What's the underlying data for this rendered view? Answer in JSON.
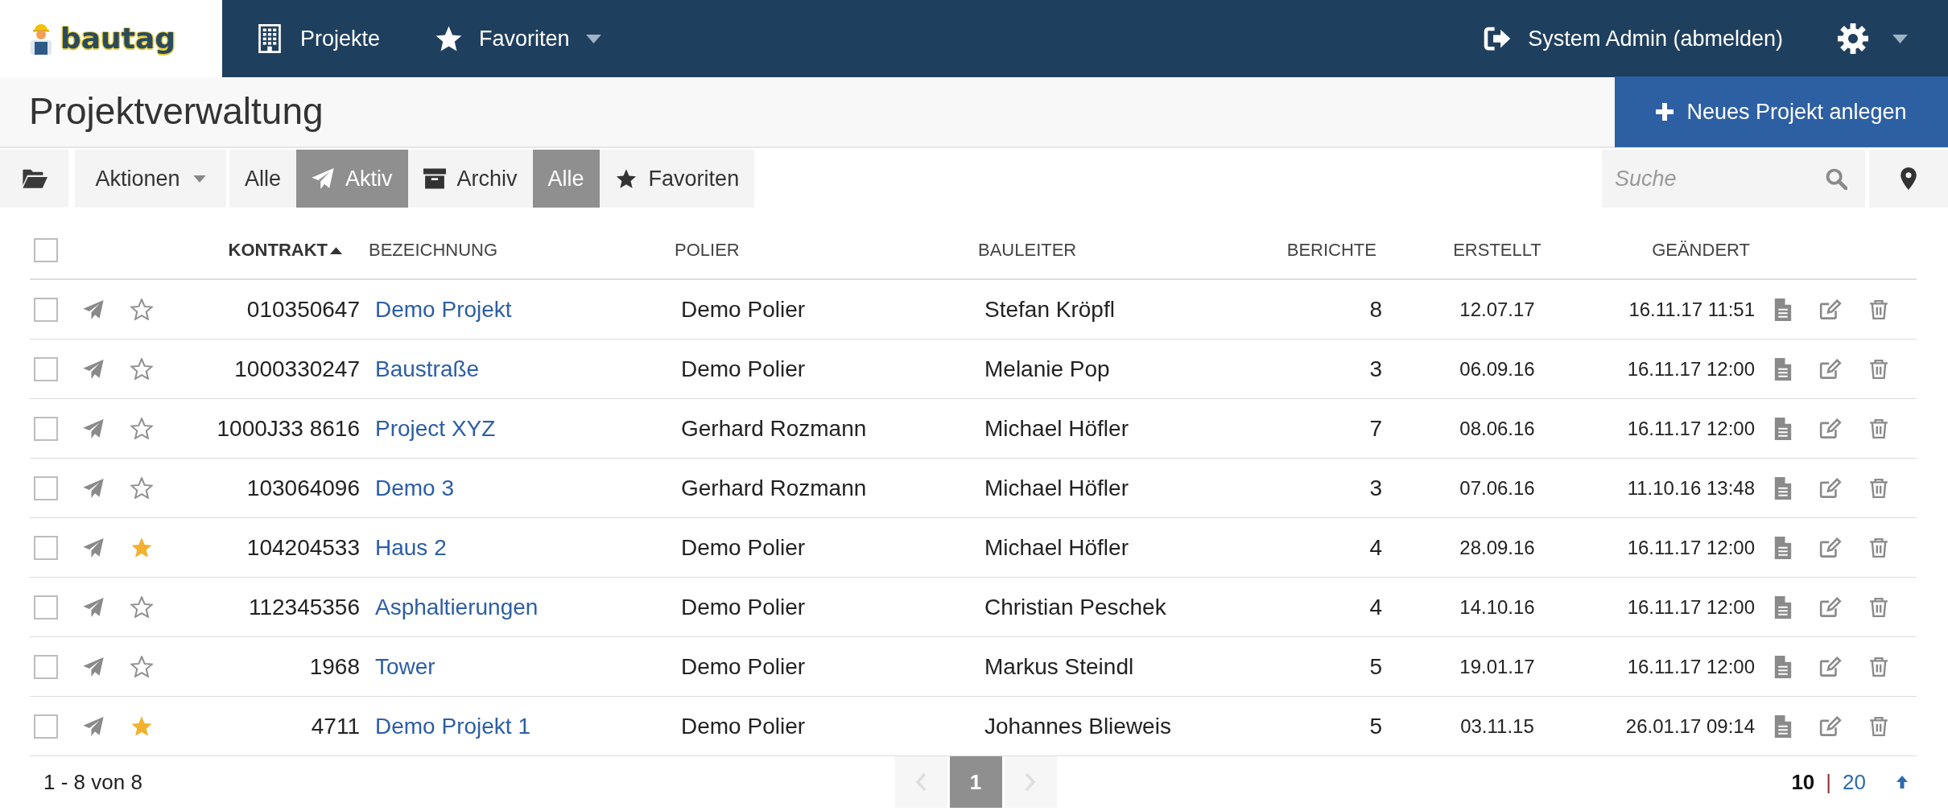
{
  "header": {
    "logo": "bautag",
    "nav": [
      {
        "label": "Projekte",
        "kind": "projects"
      },
      {
        "label": "Favoriten",
        "kind": "favorites"
      }
    ],
    "user": "System Admin (abmelden)"
  },
  "page": {
    "title": "Projektverwaltung",
    "new_button": "Neues Projekt anlegen"
  },
  "toolbar": {
    "actions": "Aktionen",
    "status_filters": [
      {
        "label": "Alle",
        "kind": "all",
        "selected": false
      },
      {
        "label": "Aktiv",
        "kind": "active",
        "selected": true
      },
      {
        "label": "Archiv",
        "kind": "archive",
        "selected": false
      }
    ],
    "favorite_filters": [
      {
        "label": "Alle",
        "kind": "all",
        "selected": true
      },
      {
        "label": "Favoriten",
        "kind": "favorites",
        "selected": false
      }
    ],
    "search": {
      "placeholder": "Suche"
    }
  },
  "table": {
    "select_all": {
      "checked": false
    },
    "columns": [
      {
        "label": "KONTRAKT",
        "sorted": true
      },
      {
        "label": "BEZEICHNUNG",
        "sorted": false
      },
      {
        "label": "POLIER",
        "sorted": false
      },
      {
        "label": "BAULEITER",
        "sorted": false
      },
      {
        "label": "BERICHTE",
        "sorted": false
      },
      {
        "label": "ERSTELLT",
        "sorted": false
      },
      {
        "label": "GEÄNDERT",
        "sorted": false
      }
    ],
    "rows": [
      {
        "checked": false,
        "favorite": false,
        "kontrakt": "010350647",
        "bezeichnung": "Demo Projekt",
        "polier": "Demo Polier",
        "bauleiter": "Stefan Kröpfl",
        "berichte": "8",
        "erstellt": "12.07.17",
        "geaendert": "16.11.17 11:51"
      },
      {
        "checked": false,
        "favorite": false,
        "kontrakt": "1000330247",
        "bezeichnung": "Baustraße",
        "polier": "Demo Polier",
        "bauleiter": "Melanie Pop",
        "berichte": "3",
        "erstellt": "06.09.16",
        "geaendert": "16.11.17 12:00"
      },
      {
        "checked": false,
        "favorite": false,
        "kontrakt": "1000J33 8616",
        "bezeichnung": "Project XYZ",
        "polier": "Gerhard Rozmann",
        "bauleiter": "Michael Höfler",
        "berichte": "7",
        "erstellt": "08.06.16",
        "geaendert": "16.11.17 12:00"
      },
      {
        "checked": false,
        "favorite": false,
        "kontrakt": "103064096",
        "bezeichnung": "Demo 3",
        "polier": "Gerhard Rozmann",
        "bauleiter": "Michael Höfler",
        "berichte": "3",
        "erstellt": "07.06.16",
        "geaendert": "11.10.16 13:48"
      },
      {
        "checked": false,
        "favorite": true,
        "kontrakt": "104204533",
        "bezeichnung": "Haus 2",
        "polier": "Demo Polier",
        "bauleiter": "Michael Höfler",
        "berichte": "4",
        "erstellt": "28.09.16",
        "geaendert": "16.11.17 12:00"
      },
      {
        "checked": false,
        "favorite": false,
        "kontrakt": "112345356",
        "bezeichnung": "Asphaltierungen",
        "polier": "Demo Polier",
        "bauleiter": "Christian Peschek",
        "berichte": "4",
        "erstellt": "14.10.16",
        "geaendert": "16.11.17 12:00"
      },
      {
        "checked": false,
        "favorite": false,
        "kontrakt": "1968",
        "bezeichnung": "Tower",
        "polier": "Demo Polier",
        "bauleiter": "Markus Steindl",
        "berichte": "5",
        "erstellt": "19.01.17",
        "geaendert": "16.11.17 12:00"
      },
      {
        "checked": false,
        "favorite": true,
        "kontrakt": "4711",
        "bezeichnung": "Demo Projekt 1",
        "polier": "Demo Polier",
        "bauleiter": "Johannes Blieweis",
        "berichte": "5",
        "erstellt": "03.11.15",
        "geaendert": "26.01.17 09:14"
      }
    ]
  },
  "footer": {
    "range": "1 - 8 von 8",
    "pagination": {
      "prev_disabled": true,
      "next_disabled": true,
      "pages": [
        {
          "label": "1",
          "selected": true
        }
      ]
    },
    "page_sizes": [
      {
        "label": "10",
        "selected": true
      },
      {
        "label": "20",
        "selected": false
      }
    ],
    "separator": "|"
  }
}
